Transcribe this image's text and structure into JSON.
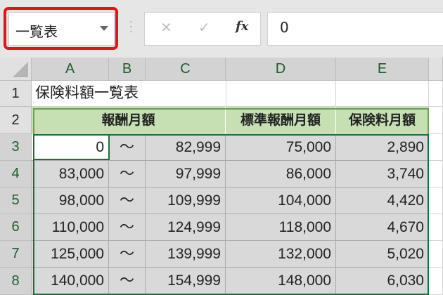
{
  "formula_bar": {
    "name_box": "一覧表",
    "cancel_icon": "✕",
    "enter_icon": "✓",
    "fx_label": "fx",
    "formula_value": "0"
  },
  "columns": [
    "A",
    "B",
    "C",
    "D",
    "E"
  ],
  "rows": [
    "1",
    "2",
    "3",
    "4",
    "5",
    "6",
    "7",
    "8"
  ],
  "sheet": {
    "title": "保険料額一覧表",
    "headers": {
      "monthly_pay": "報酬月額",
      "standard_pay": "標準報酬月額",
      "premium": "保険料月額"
    },
    "data": [
      {
        "from": "0",
        "sep": "～",
        "to": "82,999",
        "standard": "75,000",
        "premium": "2,890"
      },
      {
        "from": "83,000",
        "sep": "～",
        "to": "97,999",
        "standard": "86,000",
        "premium": "3,740"
      },
      {
        "from": "98,000",
        "sep": "～",
        "to": "109,999",
        "standard": "104,000",
        "premium": "4,420"
      },
      {
        "from": "110,000",
        "sep": "～",
        "to": "124,999",
        "standard": "118,000",
        "premium": "4,670"
      },
      {
        "from": "125,000",
        "sep": "～",
        "to": "139,999",
        "standard": "132,000",
        "premium": "5,020"
      },
      {
        "from": "140,000",
        "sep": "～",
        "to": "154,999",
        "standard": "148,000",
        "premium": "6,030"
      }
    ]
  },
  "colors": {
    "accent_green": "#1e6e3a",
    "header_green": "#c6e0b4",
    "highlight_red": "#e8101a",
    "selection_gray": "#d9d9d9"
  }
}
